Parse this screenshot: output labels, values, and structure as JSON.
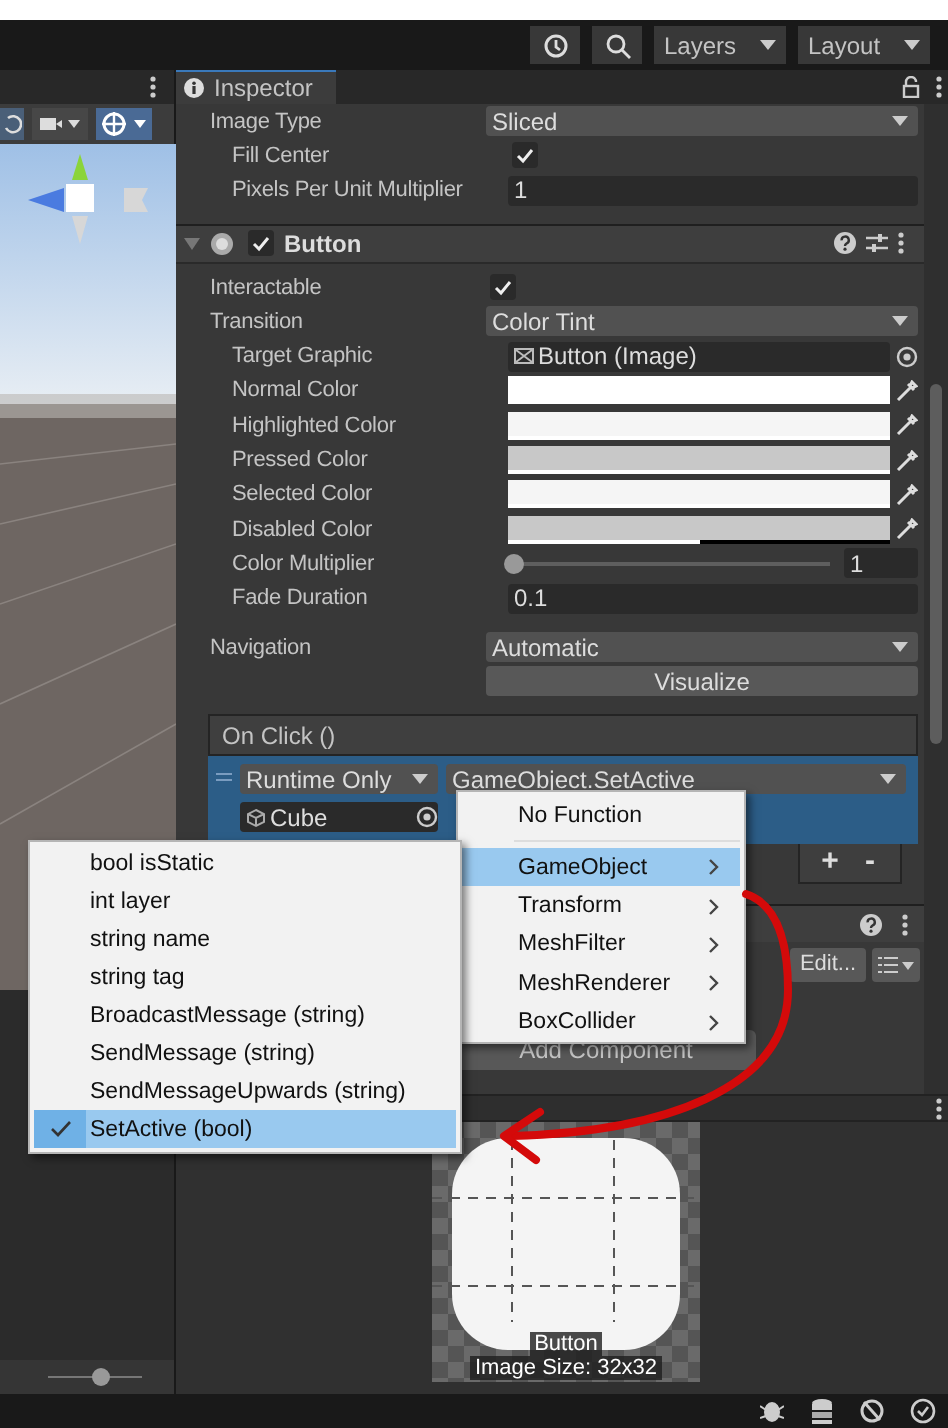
{
  "toolbar": {
    "layers": "Layers",
    "layout": "Layout"
  },
  "scene": {
    "zoom": {
      "level": 0.55
    }
  },
  "inspector": {
    "tab": "Inspector",
    "fields_top": [
      {
        "kind": "dropdown",
        "label": "Image Type",
        "value": "Sliced",
        "children": [
          {
            "kind": "checkbox",
            "label": "Fill Center",
            "checked": true
          },
          {
            "kind": "text",
            "label": "Pixels Per Unit Multiplier",
            "value": "1"
          }
        ]
      }
    ],
    "component": {
      "title": "Button",
      "enabled": true,
      "expanded": true,
      "fields": [
        {
          "kind": "checkbox",
          "label": "Interactable",
          "checked": true
        },
        {
          "kind": "dropdown",
          "label": "Transition",
          "value": "Color Tint",
          "children": [
            {
              "kind": "object",
              "label": "Target Graphic",
              "value": "Button (Image)"
            },
            {
              "kind": "color",
              "label": "Normal Color",
              "color": "#ffffff",
              "level": 1
            },
            {
              "kind": "color",
              "label": "Highlighted Color",
              "color": "#f5f5f5",
              "level": 1
            },
            {
              "kind": "color",
              "label": "Pressed Color",
              "color": "#c8c8c8",
              "level": 1
            },
            {
              "kind": "color",
              "label": "Selected Color",
              "color": "#f5f5f5",
              "level": 1
            },
            {
              "kind": "color",
              "label": "Disabled Color",
              "color": "#c8c8c8",
              "level": 0.5
            },
            {
              "kind": "slider",
              "label": "Color Multiplier",
              "level": 0,
              "value": "1"
            },
            {
              "kind": "text",
              "label": "Fade Duration",
              "value": "0.1"
            }
          ]
        },
        {
          "kind": "dropdown",
          "label": "Navigation",
          "value": "Automatic"
        }
      ],
      "visualize": "Visualize",
      "event": {
        "title": "On Click ()",
        "runtime": "Runtime Only",
        "function": "GameObject.SetActive",
        "target": "Cube",
        "add": "+",
        "remove": "-"
      }
    },
    "edit_button": "Edit...",
    "add_component": "Add Component",
    "preview": {
      "name": "Button",
      "size": "Image Size: 32x32"
    }
  },
  "function_menu": {
    "items": [
      {
        "label": "No Function",
        "submenu": false,
        "selected": false
      },
      {
        "label": "GameObject",
        "submenu": true,
        "selected": true
      },
      {
        "label": "Transform",
        "submenu": true,
        "selected": false
      },
      {
        "label": "MeshFilter",
        "submenu": true,
        "selected": false
      },
      {
        "label": "MeshRenderer",
        "submenu": true,
        "selected": false
      },
      {
        "label": "BoxCollider",
        "submenu": true,
        "selected": false
      }
    ]
  },
  "method_menu": {
    "items": [
      {
        "label": "bool isStatic",
        "selected": false
      },
      {
        "label": "int layer",
        "selected": false
      },
      {
        "label": "string name",
        "selected": false
      },
      {
        "label": "string tag",
        "selected": false
      },
      {
        "label": "BroadcastMessage (string)",
        "selected": false
      },
      {
        "label": "SendMessage (string)",
        "selected": false
      },
      {
        "label": "SendMessageUpwards (string)",
        "selected": false
      },
      {
        "label": "SetActive (bool)",
        "selected": true
      }
    ]
  }
}
